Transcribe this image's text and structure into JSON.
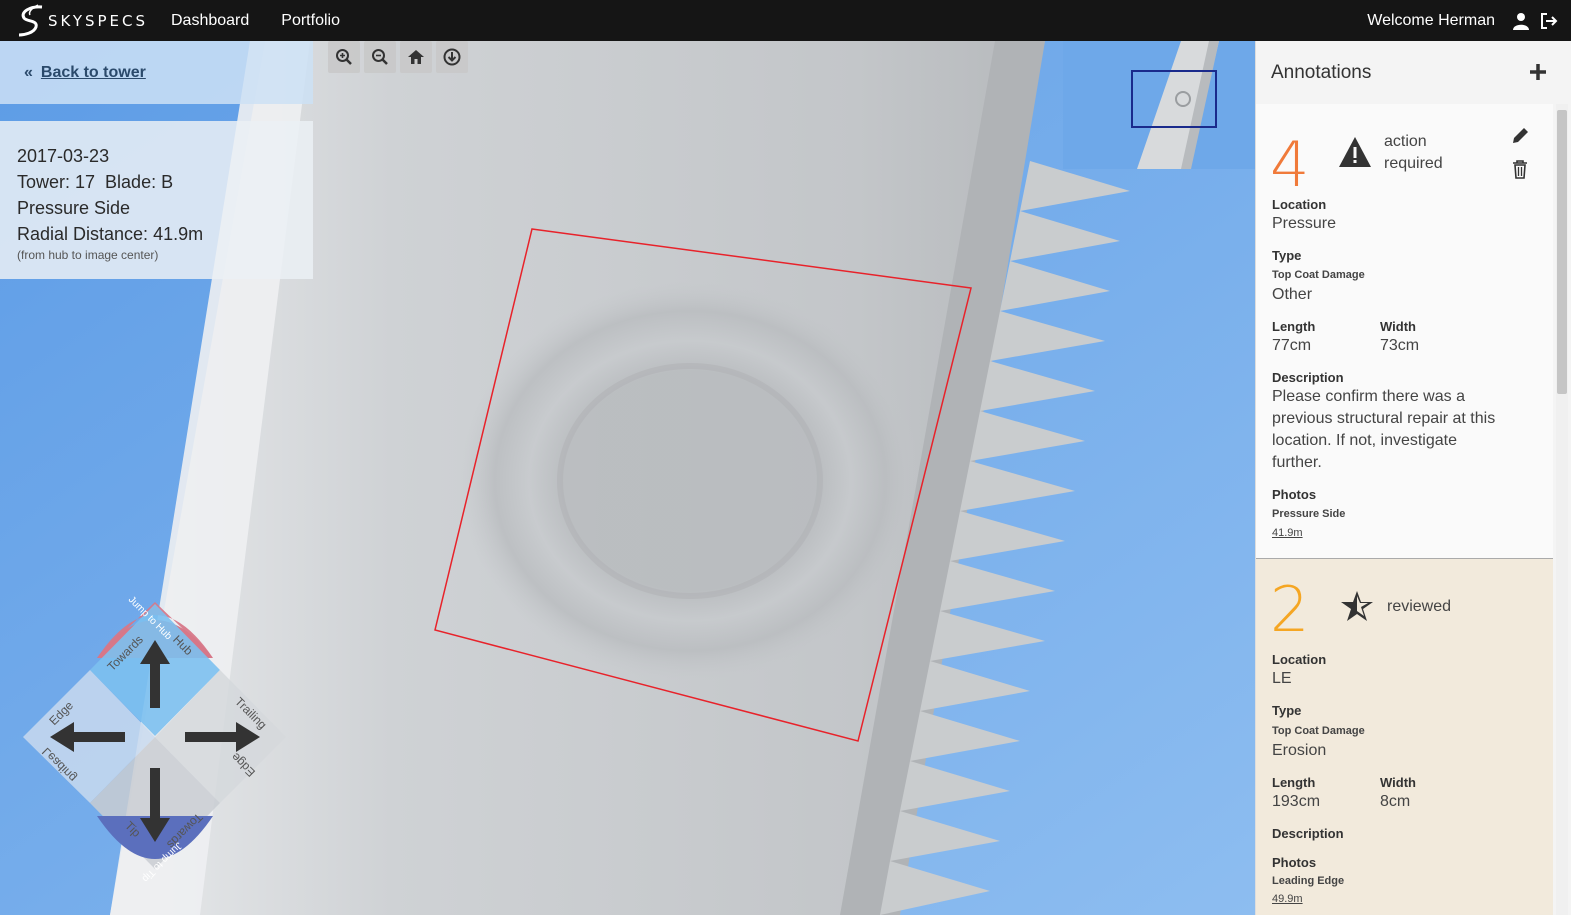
{
  "topbar": {
    "logo_text": "SKYSPECS",
    "nav": [
      "Dashboard",
      "Portfolio"
    ],
    "welcome": "Welcome Herman",
    "user_icon": "user-icon",
    "logout_icon": "logout-icon"
  },
  "back": {
    "label": "Back to tower",
    "icon": "double-chevron-left-icon"
  },
  "info": {
    "date": "2017-03-23",
    "tower_blade": "Tower: 17  Blade: B",
    "side": "Pressure Side",
    "radial": "Radial Distance: 41.9m",
    "note": "(from hub to image center)"
  },
  "tools": [
    "zoom-in-icon",
    "zoom-out-icon",
    "home-icon",
    "download-icon"
  ],
  "navpad": {
    "jump_hub": "Jump to Hub",
    "towards_hub_a": "Towards",
    "towards_hub_b": "Hub",
    "trailing_a": "Trailing",
    "trailing_b": "Edge",
    "leading_a": "Edge",
    "leading_b": "Leading",
    "towards_tip_a": "Tip",
    "towards_tip_b": "Towards",
    "jump_tip": "Jump to Tip"
  },
  "panel": {
    "title": "Annotations",
    "annotations": [
      {
        "severity": "4",
        "severity_color": "#f07a3a",
        "status_line1": "action",
        "status_line2": "required",
        "status_icon": "warning-icon",
        "location_label": "Location",
        "location": "Pressure",
        "type_label": "Type",
        "type_category": "Top Coat Damage",
        "type": "Other",
        "length_label": "Length",
        "length": "77cm",
        "width_label": "Width",
        "width": "73cm",
        "description_label": "Description",
        "description": "Please confirm there was a previous structural repair at this location. If not, investigate further.",
        "photos_label": "Photos",
        "photo_side": "Pressure Side",
        "photo_link": "41.9m"
      },
      {
        "severity": "2",
        "severity_color": "#f5a623",
        "status_line1": "reviewed",
        "status_icon": "star-icon",
        "location_label": "Location",
        "location": "LE",
        "type_label": "Type",
        "type_category": "Top Coat Damage",
        "type": "Erosion",
        "length_label": "Length",
        "length": "193cm",
        "width_label": "Width",
        "width": "8cm",
        "description_label": "Description",
        "photos_label": "Photos",
        "photo_side": "Leading Edge",
        "photo_link": "49.9m"
      }
    ]
  }
}
